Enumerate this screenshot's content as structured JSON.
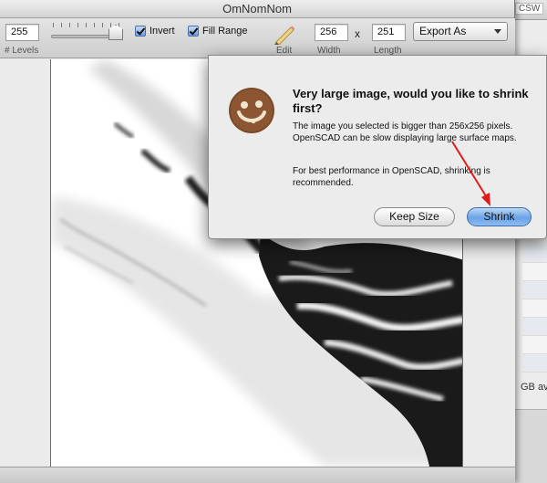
{
  "window": {
    "title": "OmNomNom"
  },
  "toolbar": {
    "levels_value": "255",
    "levels_label": "# Levels",
    "invert_label": "Invert",
    "invert_checked": true,
    "fill_range_label": "Fill Range",
    "fill_range_checked": true,
    "edit_label": "Edit",
    "width_value": "256",
    "width_label": "Width",
    "times_symbol": "x",
    "length_value": "251",
    "length_label": "Length",
    "export_label": "Export As"
  },
  "background_window": {
    "tag_text": "CSW",
    "status_text": "GB availa"
  },
  "dialog": {
    "title": "Very large image, would you like to shrink first?",
    "message1": "The image you selected is bigger than 256x256 pixels.  OpenSCAD can be slow displaying large surface maps.",
    "message2": "For best performance in OpenSCAD, shrinking is recommended.",
    "keep_size_label": "Keep Size",
    "shrink_label": "Shrink"
  },
  "icons": {
    "app_icon": "cookie-smiley-icon",
    "edit_icon": "pencil-icon",
    "popup_chevron": "chevron-down-icon"
  },
  "colors": {
    "accent_button": "#6aa3e8",
    "canvas_border": "#c02cc0",
    "annotation_arrow": "#e01b1b"
  }
}
